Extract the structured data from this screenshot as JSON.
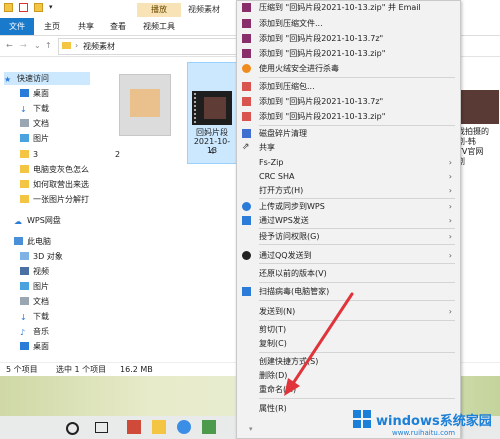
{
  "titlebar": {
    "context_tab": "播放",
    "title": "视频素材"
  },
  "ribbon": {
    "tabs": [
      "文件",
      "主页",
      "共享",
      "查看",
      "视频工具"
    ]
  },
  "address": {
    "path": "视频素材"
  },
  "sidebar": {
    "items": [
      {
        "label": "快速访问",
        "icon": "star-icon"
      },
      {
        "label": "桌面",
        "icon": "desktop-icon"
      },
      {
        "label": "下载",
        "icon": "download-icon"
      },
      {
        "label": "文档",
        "icon": "document-icon"
      },
      {
        "label": "图片",
        "icon": "picture-icon"
      },
      {
        "label": "3",
        "icon": "folder-icon"
      },
      {
        "label": "电脑变灰色怎么",
        "icon": "folder-icon"
      },
      {
        "label": "如何取营出来选",
        "icon": "folder-icon"
      },
      {
        "label": "一张图片分解打",
        "icon": "folder-icon"
      },
      {
        "label": "WPS网盘",
        "icon": "cloud-icon"
      },
      {
        "label": "此电脑",
        "icon": "computer-icon"
      },
      {
        "label": "3D 对象",
        "icon": "cube-icon"
      },
      {
        "label": "视频",
        "icon": "video-icon"
      },
      {
        "label": "图片",
        "icon": "picture-icon"
      },
      {
        "label": "文档",
        "icon": "document-icon"
      },
      {
        "label": "下载",
        "icon": "download-icon"
      },
      {
        "label": "音乐",
        "icon": "music-icon"
      },
      {
        "label": "桌面",
        "icon": "desktop-icon"
      }
    ]
  },
  "content": {
    "item1_label": "2",
    "item2_label": "回妈片段",
    "item2_label2": "2021-10-13",
    "item2_label3": "4",
    "item3_label": "我拍摄的",
    "item3_label2": "剧-韩",
    "item3_label3": "TV官网",
    "item3_label4": "剧"
  },
  "status": {
    "count": "5 个项目",
    "selected": "选中 1 个项目",
    "size": "16.2 MB"
  },
  "menu": {
    "items": [
      {
        "label": "压缩到 \"回妈片段2021-10-13.zip\" 并 Email",
        "icon": "winrar-icon",
        "arrow": ""
      },
      {
        "label": "添加到压缩文件...",
        "icon": "winrar-icon",
        "arrow": ""
      },
      {
        "label": "添加到 \"回妈片段2021-10-13.7z\"",
        "icon": "winrar-icon",
        "arrow": ""
      },
      {
        "label": "添加到 \"回妈片段2021-10-13.zip\"",
        "icon": "winrar-icon",
        "arrow": ""
      },
      {
        "label": "使用火绒安全进行杀毒",
        "icon": "huorong-icon",
        "arrow": ""
      },
      {
        "label": "添加到压缩包...",
        "icon": "bandizip-icon",
        "arrow": ""
      },
      {
        "label": "添加到 \"回妈片段2021-10-13.7z\"",
        "icon": "bandizip-icon",
        "arrow": ""
      },
      {
        "label": "添加到 \"回妈片段2021-10-13.zip\"",
        "icon": "bandizip-icon",
        "arrow": ""
      },
      {
        "label": "磁盘碎片清理",
        "icon": "cleaner-icon",
        "arrow": ""
      },
      {
        "label": "共享",
        "icon": "share-icon",
        "arrow": ""
      },
      {
        "label": "Fs-Zip",
        "icon": "",
        "arrow": "›"
      },
      {
        "label": "CRC SHA",
        "icon": "",
        "arrow": "›"
      },
      {
        "label": "打开方式(H)",
        "icon": "",
        "arrow": "›"
      },
      {
        "label": "上传或同步到WPS",
        "icon": "wps-cloud-icon",
        "arrow": "›"
      },
      {
        "label": "通过WPS发送",
        "icon": "wps-send-icon",
        "arrow": "›"
      },
      {
        "label": "授予访问权限(G)",
        "icon": "",
        "arrow": "›"
      },
      {
        "label": "通过QQ发送到",
        "icon": "qq-icon",
        "arrow": "›"
      },
      {
        "label": "还原以前的版本(V)",
        "icon": "",
        "arrow": ""
      },
      {
        "label": "扫描病毒(电脑管家)",
        "icon": "shield-icon",
        "arrow": ""
      },
      {
        "label": "发送到(N)",
        "icon": "",
        "arrow": "›"
      },
      {
        "label": "剪切(T)",
        "icon": "",
        "arrow": ""
      },
      {
        "label": "复制(C)",
        "icon": "",
        "arrow": ""
      },
      {
        "label": "创建快捷方式(S)",
        "icon": "",
        "arrow": ""
      },
      {
        "label": "删除(D)",
        "icon": "",
        "arrow": ""
      },
      {
        "label": "重命名(M)",
        "icon": "",
        "arrow": ""
      },
      {
        "label": "属性(R)",
        "icon": "",
        "arrow": ""
      }
    ]
  },
  "watermark": {
    "line1": "windows系统家园",
    "line2": "www.ruihaitu.com"
  },
  "colors": {
    "file_tab": "#1979ca",
    "arrow": "#e0343a",
    "menu_bg": "#f2f2f2",
    "selection": "#cce8ff"
  }
}
